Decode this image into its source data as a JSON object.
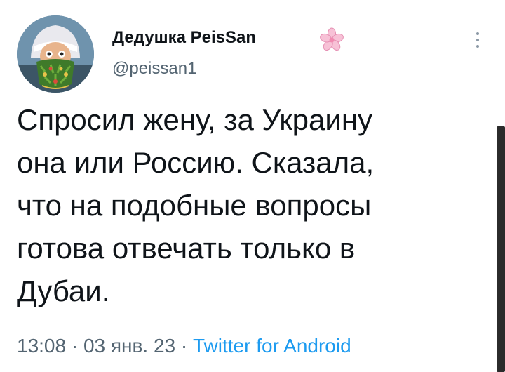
{
  "author": {
    "display_name": "Дедушка PeisSan",
    "handle": "@peissan1",
    "avatar_icon": "avatar-santa-icon",
    "badge_icon": "sakura-flower-icon",
    "badge_color": "#f4a7c4"
  },
  "tweet": {
    "lines": [
      "Спросил жену, за Украину",
      "она или Россию. Сказала,",
      "что на подобные вопросы",
      "готова отвечать только в",
      "Дубаи."
    ]
  },
  "meta": {
    "time": "13:08",
    "separator1": " · ",
    "date": "03 янв. 23",
    "separator2": " · ",
    "source": "Twitter for Android"
  },
  "more_icon": "more-vertical-icon",
  "colors": {
    "link": "#1d9bf0",
    "secondary": "#536471",
    "text": "#0f1419"
  }
}
